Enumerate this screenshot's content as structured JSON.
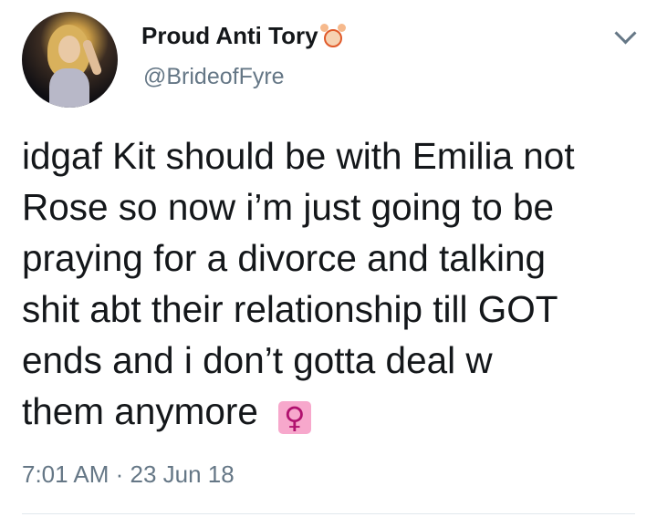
{
  "tweet": {
    "author": {
      "display_name": "Proud Anti Tory",
      "handle": "@BrideofFyre",
      "name_emoji": "person-gesturing-ok-icon"
    },
    "text_lines": [
      "idgaf Kit should be with Emilia not",
      "Rose so now i’m just going to be",
      "praying for a divorce and talking",
      "shit abt their relationship till GOT",
      "ends and i don’t gotta deal w",
      "them anymore"
    ],
    "trailing_emoji": "♀",
    "timestamp": "7:01 AM · 23 Jun 18"
  },
  "colors": {
    "text": "#14171a",
    "secondary": "#657786",
    "emoji_bg": "#f7a8cc",
    "divider": "#e1e8ed"
  }
}
